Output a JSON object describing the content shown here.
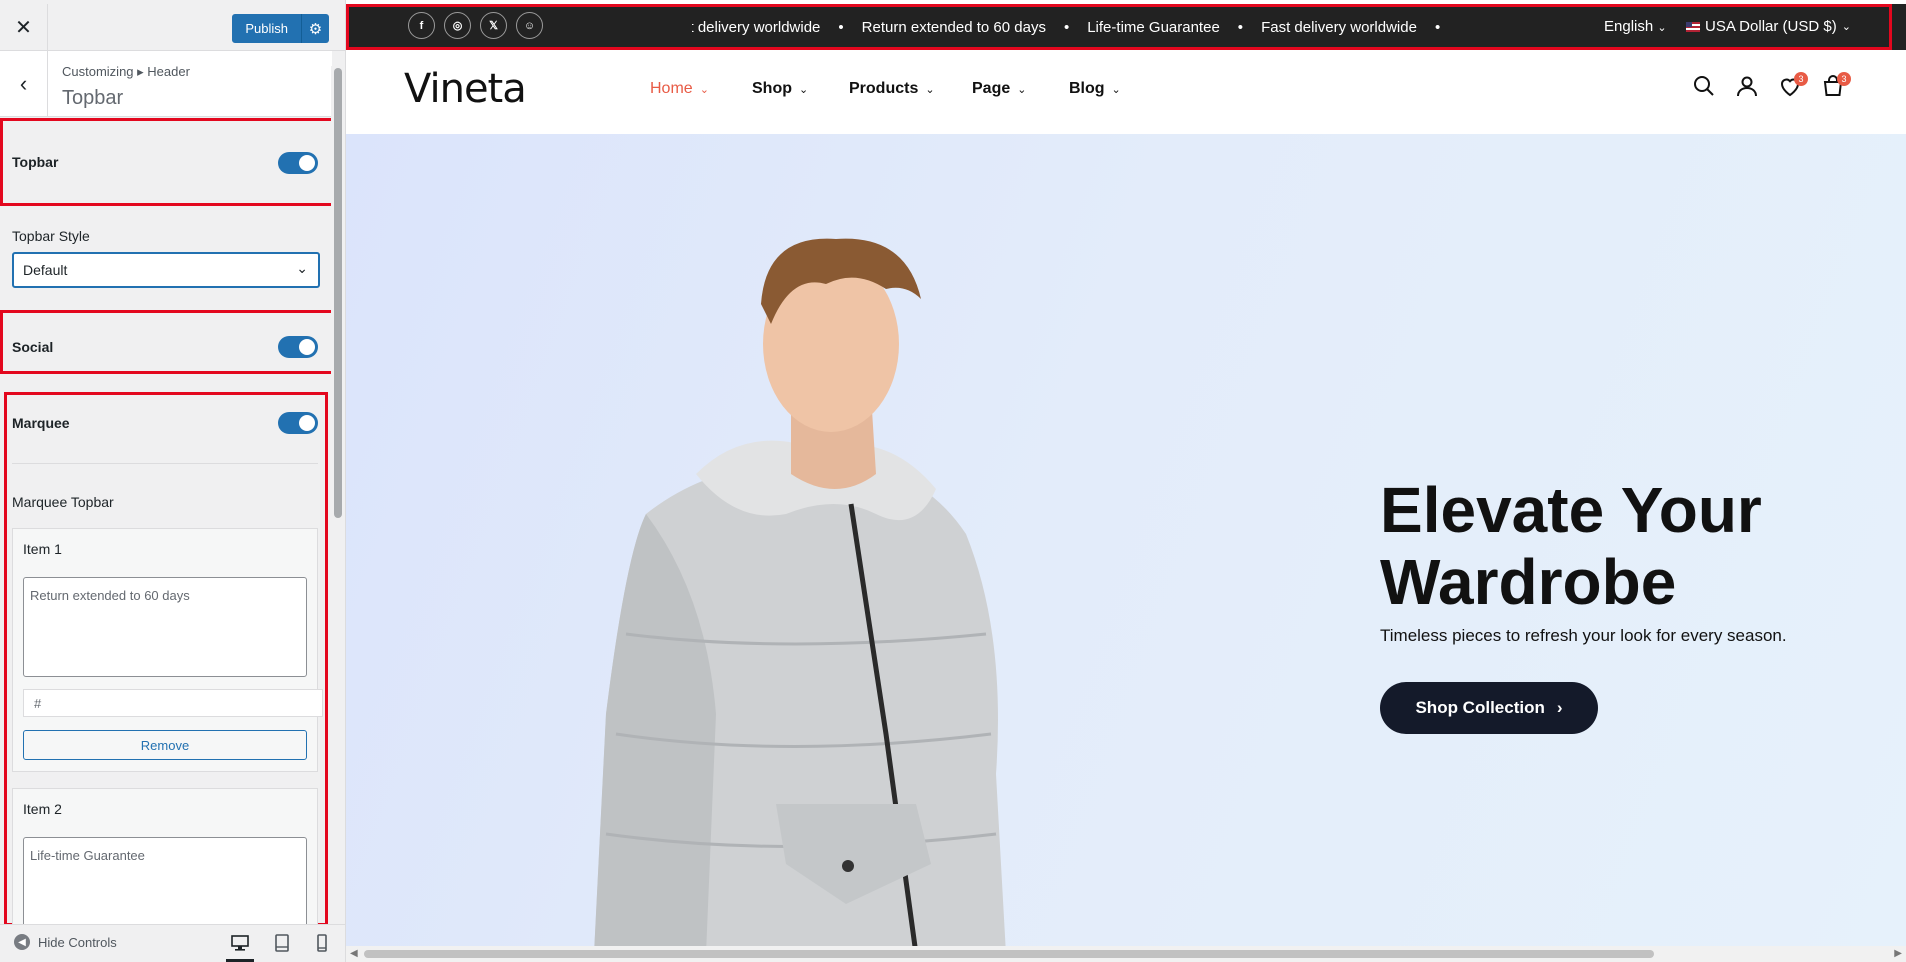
{
  "sidebar": {
    "close_icon": "close-icon",
    "publish_label": "Publish",
    "breadcrumb": "Customizing ▸ Header",
    "section_title": "Topbar",
    "controls": {
      "topbar_label": "Topbar",
      "topbar_enabled": true,
      "style_label": "Topbar Style",
      "style_value": "Default",
      "social_label": "Social",
      "social_enabled": true,
      "marquee_label": "Marquee",
      "marquee_enabled": true,
      "marquee_topbar_label": "Marquee Topbar",
      "items": [
        {
          "title": "Item 1",
          "text": "Return extended to 60 days",
          "link": "#",
          "remove_label": "Remove"
        },
        {
          "title": "Item 2",
          "text": "Life-time Guarantee"
        }
      ]
    },
    "footer": {
      "hide_controls_label": "Hide Controls"
    },
    "accent_color": "#2271b1",
    "highlight_color": "#e3071e"
  },
  "preview": {
    "topbar": {
      "social_icons": [
        "facebook-icon",
        "instagram-icon",
        "x-icon",
        "snapchat-icon"
      ],
      "marquee_items": [
        "st delivery worldwide",
        "Return extended to 60 days",
        "Life-time Guarantee",
        "Fast delivery worldwide"
      ],
      "language": "English",
      "currency": "USA Dollar (USD $)"
    },
    "header": {
      "logo": "Vineta",
      "nav": [
        {
          "label": "Home",
          "active": true
        },
        {
          "label": "Shop"
        },
        {
          "label": "Products"
        },
        {
          "label": "Page"
        },
        {
          "label": "Blog"
        }
      ],
      "wishlist_count": "3",
      "cart_count": "3"
    },
    "hero": {
      "title_line1": "Elevate Your",
      "title_line2": "Wardrobe",
      "subtitle": "Timeless pieces to refresh your look for every season.",
      "cta_label": "Shop Collection"
    }
  }
}
